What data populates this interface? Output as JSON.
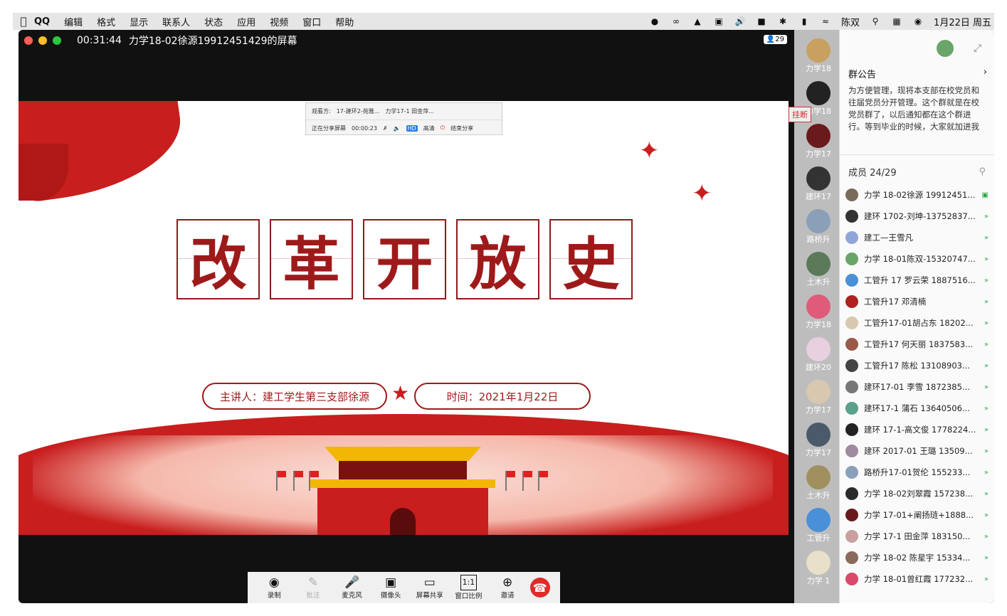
{
  "menubar": {
    "items": [
      "QQ",
      "编辑",
      "格式",
      "显示",
      "联系人",
      "状态",
      "应用",
      "视频",
      "窗口",
      "帮助"
    ],
    "user": "陈双",
    "datetime": "1月22日 周五"
  },
  "window": {
    "timer": "00:31:44",
    "title": "力学18-02徐源19912451429的屏幕",
    "participant_count": "29"
  },
  "share_bar": {
    "viewers_label": "观看方:",
    "viewer1": "17-建环2-苑雅...",
    "viewer2": "力学17-1 田金萍...",
    "sharing_label": "正在分享屏幕",
    "sharing_time": "00:00:23",
    "hd_badge": "HD",
    "hd_label": "高清",
    "end_label": "结束分享"
  },
  "slide": {
    "title_chars": [
      "改",
      "革",
      "开",
      "放",
      "史"
    ],
    "presenter": "主讲人：建工学生第三支部徐源",
    "time": "时间：2021年1月22日"
  },
  "toolbar": {
    "record": "录制",
    "annotate": "批注",
    "mic": "麦克风",
    "camera": "摄像头",
    "screen_share": "屏幕共享",
    "ratio": "窗口比例",
    "ratio_icon": "1:1",
    "invite": "邀请"
  },
  "strip": {
    "labels": [
      "力学18",
      "力学18",
      "力学17",
      "建环17",
      "路桥升",
      "土木升",
      "力学18",
      "建环20",
      "力学17",
      "力学17",
      "土木升",
      "工管升",
      "力学 1"
    ],
    "hang_label": "挂断"
  },
  "panel": {
    "notice_title": "群公告",
    "notice_text": "为方便管理，现将本支部在校党员和往届党员分开管理。这个群就是在校党员群了，以后通知都在这个群进行。等到毕业的时候，大家就加进我们以前的群里。往届党员群就相当于一",
    "members_label": "成员 24/29",
    "members": [
      {
        "name": "力学 18-02徐源 19912451...",
        "color": "#7a6a5a"
      },
      {
        "name": "建环 1702-刘坤-13752837...",
        "color": "#333333"
      },
      {
        "name": "建工—王雪凡",
        "color": "#8fa5d8"
      },
      {
        "name": "力学 18-01陈双-15320747...",
        "color": "#6aa56a"
      },
      {
        "name": "工管升 17 罗云荣 1887516...",
        "color": "#4a90d9"
      },
      {
        "name": "工管升17  邓清楠",
        "color": "#b02020"
      },
      {
        "name": "工管升17-01胡占东 18202...",
        "color": "#d8c8b0"
      },
      {
        "name": "工管升17 何天丽 1837583...",
        "color": "#9a5a4a"
      },
      {
        "name": "工管升17 陈松 13108903...",
        "color": "#444444"
      },
      {
        "name": "建环17-01 李雪 1872385...",
        "color": "#777777"
      },
      {
        "name": "建环17-1 蒲石 13640506...",
        "color": "#5aa08a"
      },
      {
        "name": "建环 17-1-高文俊 1778224...",
        "color": "#222222"
      },
      {
        "name": "建环 2017-01 王璐 13509...",
        "color": "#a08aa0"
      },
      {
        "name": "路桥升17-01贺伦 155233...",
        "color": "#8aa0b8"
      },
      {
        "name": "力学 18-02刘翠霞 157238...",
        "color": "#2a2a2a"
      },
      {
        "name": "力学 17-01+阐扬琏+1888...",
        "color": "#6a1a1a"
      },
      {
        "name": "力学 17-1 田金萍  183150...",
        "color": "#c8a0a0"
      },
      {
        "name": "力学 18-02  陈星宇 15334...",
        "color": "#8a6a5a"
      },
      {
        "name": "力学 18-01曾红霞 177232...",
        "color": "#d84a6a"
      }
    ]
  }
}
